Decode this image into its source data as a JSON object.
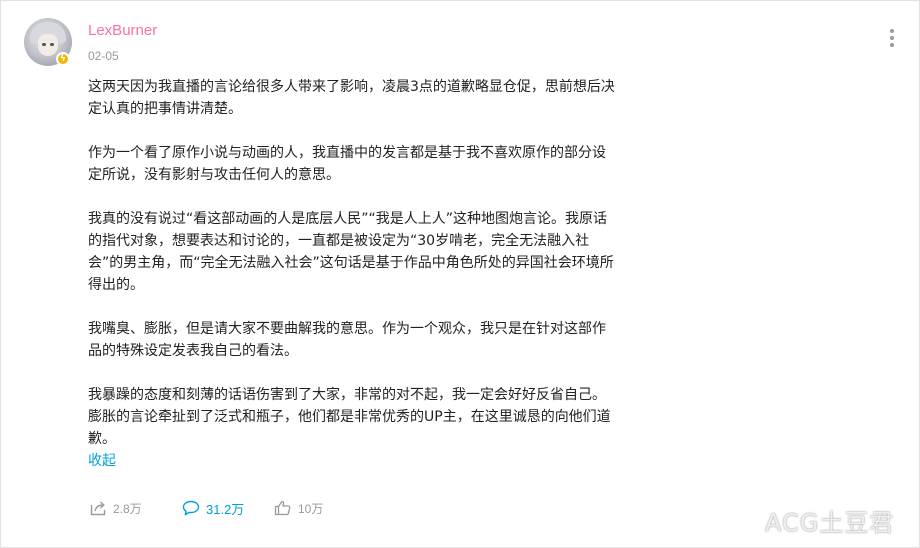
{
  "post": {
    "username": "LexBurner",
    "date": "02-05",
    "paragraphs": [
      "这两天因为我直播的言论给很多人带来了影响，凌晨3点的道歉略显仓促，思前想后决定认真的把事情讲清楚。",
      "作为一个看了原作小说与动画的人，我直播中的发言都是基于我不喜欢原作的部分设定所说，没有影射与攻击任何人的意思。",
      "我真的没有说过“看这部动画的人是底层人民”“我是人上人”这种地图炮言论。我原话的指代对象，想要表达和讨论的，一直都是被设定为“30岁啃老，完全无法融入社会”的男主角，而“完全无法融入社会”这句话是基于作品中角色所处的异国社会环境所得出的。",
      "我嘴臭、膨胀，但是请大家不要曲解我的意思。作为一个观众，我只是在针对这部作品的特殊设定发表我自己的看法。",
      "我暴躁的态度和刻薄的话语伤害到了大家，非常的对不起，我一定会好好反省自己。膨胀的言论牵扯到了泛式和瓶子，他们都是非常优秀的UP主，在这里诚恳的向他们道歉。"
    ],
    "collapse_label": "收起"
  },
  "actions": {
    "share_count": "2.8万",
    "comment_count": "31.2万",
    "like_count": "10万"
  },
  "watermark": "ACG土豆君",
  "colors": {
    "username": "#fb7299",
    "link": "#00a1d6",
    "muted": "#999999",
    "badge": "#f5b400"
  },
  "icons": {
    "more": "more-vertical-icon",
    "share": "share-icon",
    "comment": "comment-icon",
    "like": "thumbs-up-icon",
    "badge": "lightning-icon"
  }
}
